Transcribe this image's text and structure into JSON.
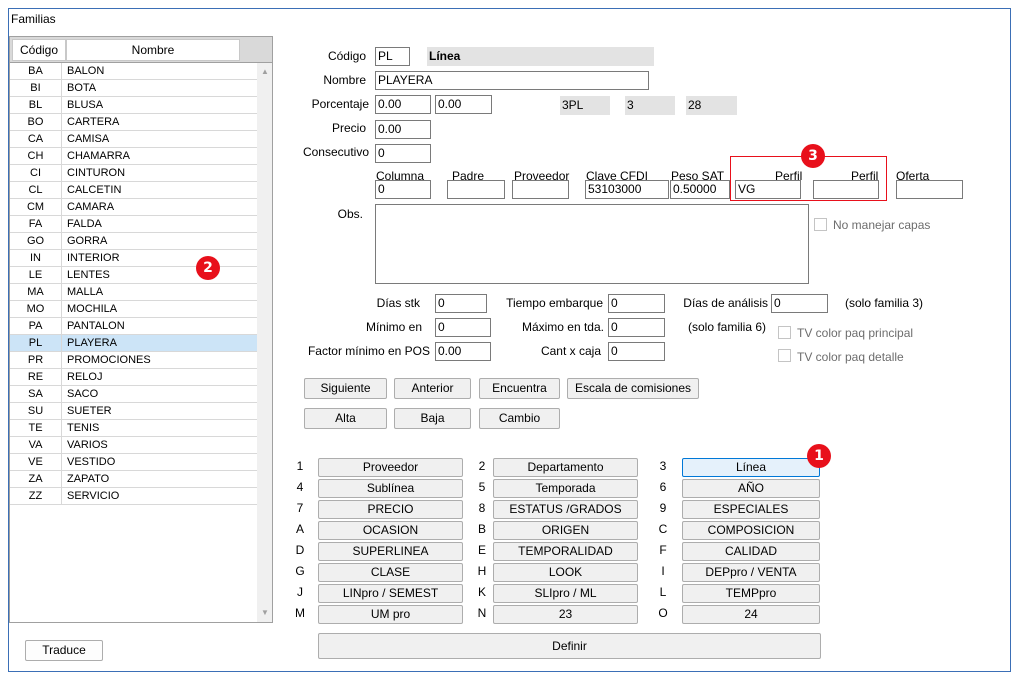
{
  "window": {
    "title": "Familias"
  },
  "grid": {
    "headers": {
      "codigo": "Código",
      "nombre": "Nombre"
    },
    "rows": [
      {
        "code": "BA",
        "name": "BALON"
      },
      {
        "code": "BI",
        "name": "BOTA"
      },
      {
        "code": "BL",
        "name": "BLUSA"
      },
      {
        "code": "BO",
        "name": "CARTERA"
      },
      {
        "code": "CA",
        "name": "CAMISA"
      },
      {
        "code": "CH",
        "name": "CHAMARRA"
      },
      {
        "code": "CI",
        "name": "CINTURON"
      },
      {
        "code": "CL",
        "name": "CALCETIN"
      },
      {
        "code": "CM",
        "name": "CAMARA"
      },
      {
        "code": "FA",
        "name": "FALDA"
      },
      {
        "code": "GO",
        "name": "GORRA"
      },
      {
        "code": "IN",
        "name": "INTERIOR"
      },
      {
        "code": "LE",
        "name": "LENTES"
      },
      {
        "code": "MA",
        "name": "MALLA"
      },
      {
        "code": "MO",
        "name": "MOCHILA"
      },
      {
        "code": "PA",
        "name": "PANTALON"
      },
      {
        "code": "PL",
        "name": "PLAYERA"
      },
      {
        "code": "PR",
        "name": "PROMOCIONES"
      },
      {
        "code": "RE",
        "name": "RELOJ"
      },
      {
        "code": "SA",
        "name": "SACO"
      },
      {
        "code": "SU",
        "name": "SUETER"
      },
      {
        "code": "TE",
        "name": "TENIS"
      },
      {
        "code": "VA",
        "name": "VARIOS"
      },
      {
        "code": "VE",
        "name": "VESTIDO"
      },
      {
        "code": "ZA",
        "name": "ZAPATO"
      },
      {
        "code": "ZZ",
        "name": "SERVICIO"
      }
    ],
    "selected_code": "PL"
  },
  "traduce_label": "Traduce",
  "form": {
    "codigo_label": "Código",
    "codigo_value": "PL",
    "codigo_desc": "Línea",
    "nombre_label": "Nombre",
    "nombre_value": "PLAYERA",
    "porcentaje_label": "Porcentaje",
    "porcentaje_1": "0.00",
    "porcentaje_2": "0.00",
    "ro_1": "3PL",
    "ro_2": "3",
    "ro_3": "28",
    "precio_label": "Precio",
    "precio_value": "0.00",
    "consecutivo_label": "Consecutivo",
    "consecutivo_value": "0",
    "columna_label": "Columna",
    "columna_value": "0",
    "padre_label": "Padre",
    "padre_value": "",
    "proveedor_label": "Proveedor",
    "proveedor_value": "",
    "clave_cfdi_label": "Clave CFDI",
    "clave_cfdi_value": "53103000",
    "peso_sat_label": "Peso SAT",
    "peso_sat_value": "0.50000",
    "perfil1_label": "Perfil",
    "perfil1_value": "VG",
    "perfil2_label": "Perfil",
    "perfil2_value": "",
    "oferta_label": "Oferta",
    "oferta_value": "",
    "obs_label": "Obs.",
    "obs_value": "",
    "no_manejar_capas": "No manejar capas",
    "dias_stk_label": "Días stk",
    "dias_stk_value": "0",
    "tiempo_embarque_label": "Tiempo embarque",
    "tiempo_embarque_value": "0",
    "dias_analisis_label": "Días de análisis",
    "dias_analisis_value": "0",
    "solo_familia_3": "(solo familia 3)",
    "minimo_en_label": "Mínimo en",
    "minimo_en_value": "0",
    "maximo_tda_label": "Máximo en tda.",
    "maximo_tda_value": "0",
    "solo_familia_6": "(solo familia 6)",
    "tv_color_principal": "TV color paq principal",
    "factor_minimo_label": "Factor mínimo en POS",
    "factor_minimo_value": "0.00",
    "cant_caja_label": "Cant x caja",
    "cant_caja_value": "0",
    "tv_color_detalle": "TV color paq detalle"
  },
  "actions": {
    "siguiente": "Siguiente",
    "anterior": "Anterior",
    "encuentra": "Encuentra",
    "escala": "Escala de comisiones",
    "alta": "Alta",
    "baja": "Baja",
    "cambio": "Cambio"
  },
  "families": [
    {
      "key": "1",
      "label": "Proveedor"
    },
    {
      "key": "2",
      "label": "Departamento"
    },
    {
      "key": "3",
      "label": "Línea"
    },
    {
      "key": "4",
      "label": "Sublínea"
    },
    {
      "key": "5",
      "label": "Temporada"
    },
    {
      "key": "6",
      "label": "AÑO"
    },
    {
      "key": "7",
      "label": "PRECIO"
    },
    {
      "key": "8",
      "label": "ESTATUS /GRADOS"
    },
    {
      "key": "9",
      "label": "ESPECIALES"
    },
    {
      "key": "A",
      "label": "OCASION"
    },
    {
      "key": "B",
      "label": "ORIGEN"
    },
    {
      "key": "C",
      "label": "COMPOSICION"
    },
    {
      "key": "D",
      "label": "SUPERLINEA"
    },
    {
      "key": "E",
      "label": "TEMPORALIDAD"
    },
    {
      "key": "F",
      "label": "CALIDAD"
    },
    {
      "key": "G",
      "label": "CLASE"
    },
    {
      "key": "H",
      "label": "LOOK"
    },
    {
      "key": "I",
      "label": "DEPpro / VENTA"
    },
    {
      "key": "J",
      "label": "LINpro / SEMEST"
    },
    {
      "key": "K",
      "label": "SLIpro / ML"
    },
    {
      "key": "L",
      "label": "TEMPpro"
    },
    {
      "key": "M",
      "label": "UM pro"
    },
    {
      "key": "N",
      "label": "23"
    },
    {
      "key": "O",
      "label": "24"
    }
  ],
  "definir": "Definir",
  "badges": {
    "one": "1",
    "two": "2",
    "three": "3"
  },
  "colors": {
    "accent": "#0078d7",
    "badge": "#e8101b",
    "selected_row": "#cce4f7"
  }
}
